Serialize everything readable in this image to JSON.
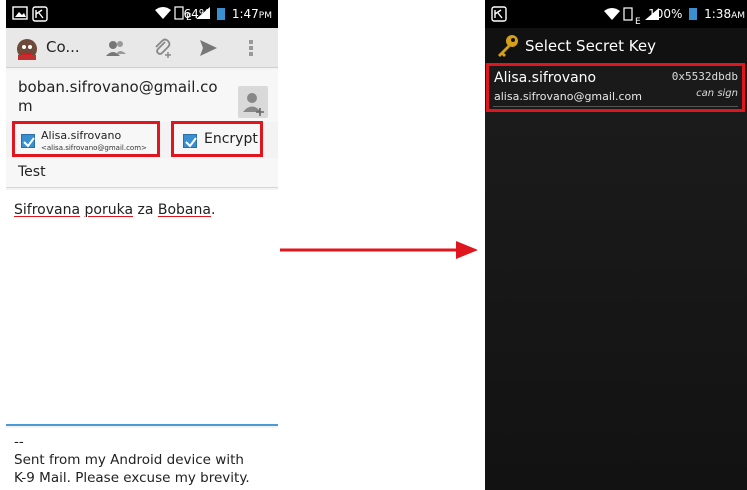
{
  "left": {
    "status_bar": {
      "battery": "64%",
      "time": "1:47",
      "ampm": "PM"
    },
    "action_bar": {
      "title": "Co..."
    },
    "to_field": {
      "value": "boban.sifrovano@gmail.com"
    },
    "signer": {
      "checked": true,
      "name": "Alisa.sifrovano",
      "email": "<alisa.sifrovano@gmail.com>"
    },
    "encrypt": {
      "checked": true,
      "label": "Encrypt"
    },
    "subject": {
      "value": "Test"
    },
    "body": {
      "words": [
        "Sifrovana",
        "poruka",
        "za",
        "Bobana",
        "."
      ]
    },
    "signature": {
      "sep": "--",
      "line1": "Sent from my Android device with",
      "line2": "K-9 Mail. Please excuse my brevity."
    }
  },
  "right": {
    "status_bar": {
      "battery": "100%",
      "time": "1:38",
      "ampm": "AM"
    },
    "action_bar": {
      "title": "Select Secret Key"
    },
    "key": {
      "name": "Alisa.sifrovano",
      "email": "alisa.sifrovano@gmail.com",
      "key_id": "0x5532dbdb",
      "capability": "can sign"
    }
  },
  "colors": {
    "highlight": "#e0161f",
    "checkbox": "#3a8fd0",
    "arrow": "#e0161f",
    "key_icon": "#d4a017"
  },
  "icons": [
    "picture-icon",
    "k9-icon",
    "wifi-icon",
    "signal-icon",
    "battery-icon",
    "attach-contact-icon",
    "attachment-icon",
    "send-icon",
    "overflow-menu-icon",
    "add-contact-icon",
    "key-icon"
  ]
}
